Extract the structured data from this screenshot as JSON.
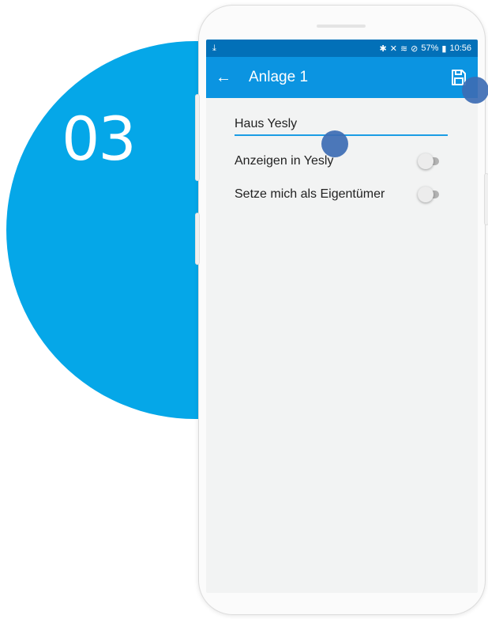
{
  "step": {
    "number": "03"
  },
  "status_bar": {
    "battery": "57%",
    "time": "10:56"
  },
  "app_bar": {
    "title": "Anlage 1"
  },
  "form": {
    "name_value": "Haus Yesly",
    "toggles": [
      {
        "label": "Anzeigen in Yesly",
        "on": false
      },
      {
        "label": "Setze mich als Eigentümer",
        "on": false
      }
    ]
  },
  "colors": {
    "accent_circle": "#05a7e8",
    "status_bar": "#0270b8",
    "app_bar": "#0b94e1",
    "touch_marker": "#3d6db4"
  }
}
